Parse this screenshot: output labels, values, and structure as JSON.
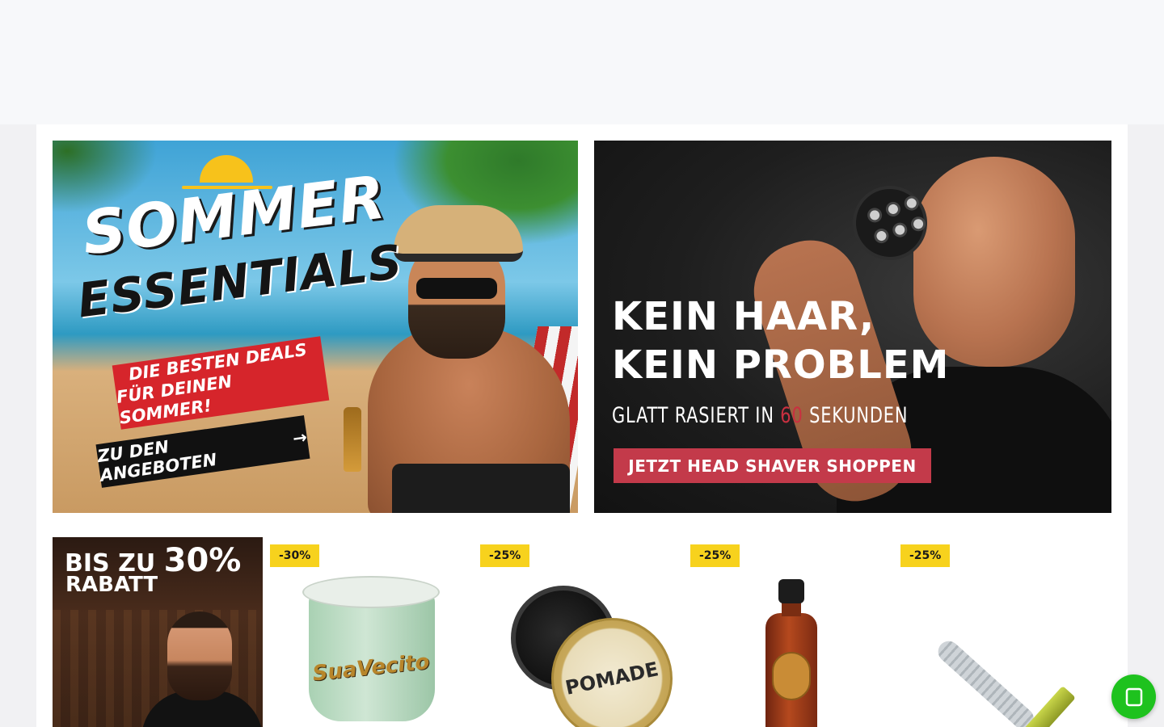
{
  "banners": {
    "summer": {
      "title_line1": "SOMMER",
      "title_line2": "ESSENTIALS",
      "ribbon_line1": "DIE BESTEN DEALS",
      "ribbon_line2": "FÜR DEINEN SOMMER!",
      "cta": "ZU DEN ANGEBOTEN",
      "cta_arrow": "→"
    },
    "shaver": {
      "title_line1": "KEIN HAAR,",
      "title_line2": "KEIN PROBLEM",
      "subtitle_pre": "GLATT RASIERT IN ",
      "subtitle_highlight": "60",
      "subtitle_post": " SEKUNDEN",
      "cta": "JETZT HEAD SHAVER SHOPPEN"
    }
  },
  "promo_tile": {
    "line1_prefix": "BIS ZU ",
    "line1_big": "30%",
    "line2": "RABATT"
  },
  "products": [
    {
      "badge": "-30%",
      "icon": "pomade-tub-green"
    },
    {
      "badge": "-25%",
      "icon": "pomade-tin"
    },
    {
      "badge": "-25%",
      "icon": "oil-bottle"
    },
    {
      "badge": "-25%",
      "icon": "safety-razor"
    }
  ],
  "floating": {
    "whatsapp_icon": "whatsapp-icon",
    "whatsapp_color": "#1ec21e"
  },
  "colors": {
    "badge_yellow": "#f7d21d",
    "shaver_cta_red": "#c33a4a",
    "ribbon_red": "#d6252b"
  }
}
